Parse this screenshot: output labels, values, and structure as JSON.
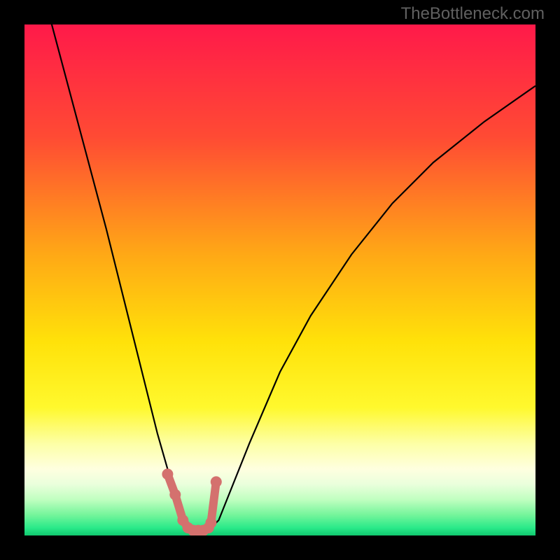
{
  "watermark": "TheBottleneck.com",
  "chart_data": {
    "type": "line",
    "title": "",
    "xlabel": "",
    "ylabel": "",
    "xlim": [
      0,
      100
    ],
    "ylim": [
      0,
      100
    ],
    "series": [
      {
        "name": "bottleneck-curve",
        "x": [
          4,
          8,
          12,
          16,
          20,
          24,
          26,
          28,
          30,
          31,
          32,
          33,
          34,
          35,
          36,
          38,
          40,
          44,
          50,
          56,
          64,
          72,
          80,
          90,
          100
        ],
        "y": [
          105,
          90,
          75,
          60,
          44,
          28,
          20,
          13,
          7,
          4,
          2,
          1,
          0.5,
          0.5,
          1,
          3,
          8,
          18,
          32,
          43,
          55,
          65,
          73,
          81,
          88
        ]
      },
      {
        "name": "marker-points",
        "x": [
          28,
          29.5,
          31,
          32,
          33,
          34,
          35,
          36,
          36.5,
          37.5
        ],
        "y": [
          12,
          8,
          3,
          1.5,
          1,
          1,
          1,
          1.5,
          2.5,
          10.5
        ]
      }
    ],
    "gradient_stops": [
      {
        "offset": 0,
        "color": "#ff1a4a"
      },
      {
        "offset": 22,
        "color": "#ff4b34"
      },
      {
        "offset": 45,
        "color": "#ffa916"
      },
      {
        "offset": 62,
        "color": "#ffe20a"
      },
      {
        "offset": 75,
        "color": "#fff92e"
      },
      {
        "offset": 82,
        "color": "#fdffa6"
      },
      {
        "offset": 87,
        "color": "#ffffe0"
      },
      {
        "offset": 90,
        "color": "#eaffdc"
      },
      {
        "offset": 93,
        "color": "#c0ffc0"
      },
      {
        "offset": 96,
        "color": "#74f59b"
      },
      {
        "offset": 98.5,
        "color": "#2aea8a"
      },
      {
        "offset": 100,
        "color": "#11c96f"
      }
    ],
    "marker_color": "#d4716e",
    "curve_color": "#000000"
  }
}
